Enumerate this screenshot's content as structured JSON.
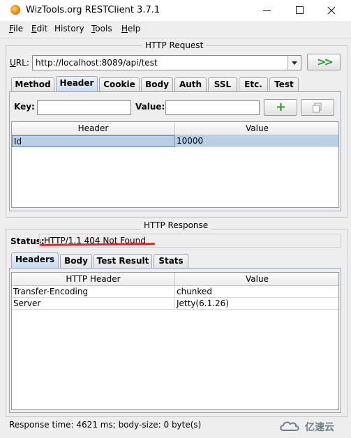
{
  "window": {
    "title": "WizTools.org RESTClient 3.7.1",
    "close_glyph": "✕"
  },
  "menu": [
    {
      "mnemonic": "F",
      "rest": "ile"
    },
    {
      "mnemonic": "E",
      "rest": "dit"
    },
    {
      "mnemonic": "",
      "rest": "History"
    },
    {
      "mnemonic": "T",
      "rest": "ools"
    },
    {
      "mnemonic": "H",
      "rest": "elp"
    }
  ],
  "request": {
    "section_title": "HTTP Request",
    "url_label": "URL:",
    "url_value": "http://localhost:8089/api/test",
    "go_glyph": ">>",
    "tabs": [
      "Method",
      "Header",
      "Cookie",
      "Body",
      "Auth",
      "SSL",
      "Etc.",
      "Test"
    ],
    "active_tab": "Header",
    "key_label": "Key:",
    "value_label": "Value:",
    "add_glyph": "+",
    "columns": [
      "Header",
      "Value"
    ],
    "rows": [
      {
        "header": "Id",
        "value": "10000"
      }
    ]
  },
  "response": {
    "section_title": "HTTP Response",
    "status_label": "Status:",
    "status_value": "HTTP/1.1 404 Not Found",
    "tabs": [
      "Headers",
      "Body",
      "Test Result",
      "Stats"
    ],
    "active_tab": "Headers",
    "columns": [
      "HTTP Header",
      "Value"
    ],
    "rows": [
      {
        "header": "Transfer-Encoding",
        "value": "chunked"
      },
      {
        "header": "Server",
        "value": "Jetty(6.1.26)"
      }
    ]
  },
  "statusbar": {
    "text": "Response time: 4621 ms; body-size: 0 byte(s)"
  },
  "watermark": {
    "text": "亿速云"
  },
  "colors": {
    "selected_row": "#b8cfe5",
    "annotation_red": "#e0262b",
    "go_arrow": "#2a9a2a"
  }
}
